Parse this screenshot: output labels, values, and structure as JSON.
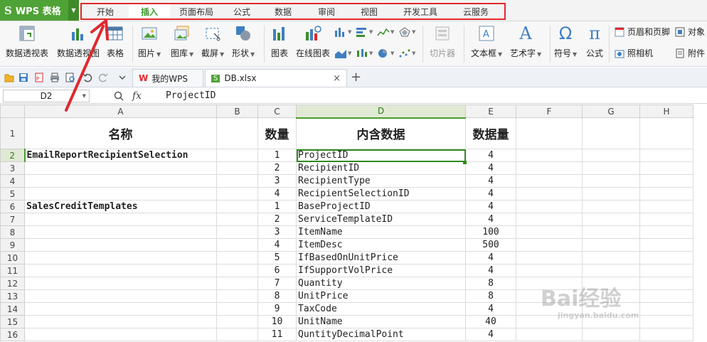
{
  "app": {
    "logo_letter": "S",
    "title": "WPS 表格"
  },
  "menu": {
    "tabs": [
      "开始",
      "插入",
      "页面布局",
      "公式",
      "数据",
      "审阅",
      "视图",
      "开发工具",
      "云服务"
    ],
    "active_index": 1
  },
  "ribbon": {
    "pivot_table": "数据透视表",
    "pivot_chart": "数据透视图",
    "table": "表格",
    "picture": "图片",
    "gallery": "图库",
    "screenshot": "截屏",
    "shapes": "形状",
    "chart": "图表",
    "online_chart": "在线图表",
    "slicer": "切片器",
    "textbox": "文本框",
    "wordart": "艺术字",
    "symbol": "符号",
    "formula": "公式",
    "header_footer": "页眉和页脚",
    "object": "对象",
    "camera": "照相机",
    "attachment": "附件",
    "icon_letters": {
      "wordart": "A",
      "symbol": "Ω",
      "formula": "π",
      "textbox": "A"
    }
  },
  "quickbar": {
    "docs": [
      {
        "name": "我的WPS",
        "logo": "W"
      },
      {
        "name": "DB.xlsx",
        "logo": "S"
      }
    ],
    "close_glyph": "×",
    "new_tab_glyph": "+"
  },
  "formula_bar": {
    "cell_ref": "D2",
    "fx_label": "fx",
    "content": "ProjectID"
  },
  "sheet": {
    "columns": [
      "A",
      "B",
      "C",
      "D",
      "E",
      "F",
      "G",
      "H"
    ],
    "selected_column": "D",
    "selected_row": 2,
    "header_row": {
      "row": 1,
      "A": "名称",
      "C": "数量",
      "D": "内含数据",
      "E": "数据量"
    },
    "rows": [
      {
        "row": 2,
        "A": "EmailReportRecipientSelection",
        "C": "1",
        "D": "ProjectID",
        "E": "4"
      },
      {
        "row": 3,
        "A": "",
        "C": "2",
        "D": "RecipientID",
        "E": "4"
      },
      {
        "row": 4,
        "A": "",
        "C": "3",
        "D": "RecipientType",
        "E": "4"
      },
      {
        "row": 5,
        "A": "",
        "C": "4",
        "D": "RecipientSelectionID",
        "E": "4"
      },
      {
        "row": 6,
        "A": "SalesCreditTemplates",
        "C": "1",
        "D": "BaseProjectID",
        "E": "4"
      },
      {
        "row": 7,
        "A": "",
        "C": "2",
        "D": "ServiceTemplateID",
        "E": "4"
      },
      {
        "row": 8,
        "A": "",
        "C": "3",
        "D": "ItemName",
        "E": "100"
      },
      {
        "row": 9,
        "A": "",
        "C": "4",
        "D": "ItemDesc",
        "E": "500"
      },
      {
        "row": 10,
        "A": "",
        "C": "5",
        "D": "IfBasedOnUnitPrice",
        "E": "4"
      },
      {
        "row": 11,
        "A": "",
        "C": "6",
        "D": "IfSupportVolPrice",
        "E": "4"
      },
      {
        "row": 12,
        "A": "",
        "C": "7",
        "D": "Quantity",
        "E": "8"
      },
      {
        "row": 13,
        "A": "",
        "C": "8",
        "D": "UnitPrice",
        "E": "8"
      },
      {
        "row": 14,
        "A": "",
        "C": "9",
        "D": "TaxCode",
        "E": "4"
      },
      {
        "row": 15,
        "A": "",
        "C": "10",
        "D": "UnitName",
        "E": "40"
      },
      {
        "row": 16,
        "A": "",
        "C": "11",
        "D": "QuntityDecimalPoint",
        "E": "4"
      }
    ]
  },
  "watermark": {
    "brand": "Bai经验",
    "url": "jingyan.baidu.com"
  },
  "colors": {
    "brand_green": "#4fa236",
    "active_tab_text": "#3d9a2b",
    "highlight_red": "#e0282e",
    "selection_green": "#2f8a1e"
  }
}
